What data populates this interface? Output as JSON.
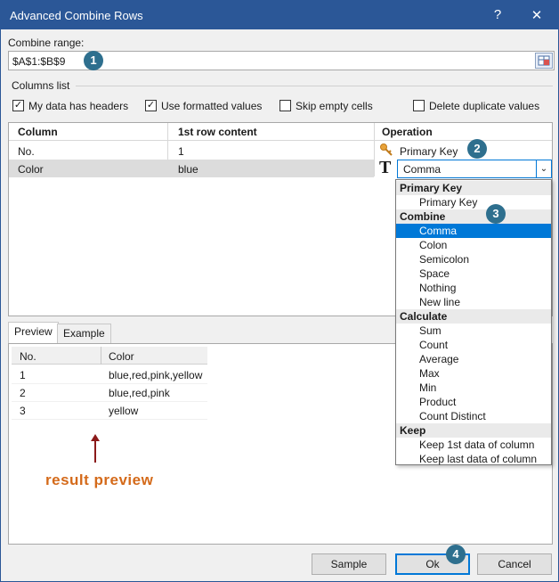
{
  "window": {
    "title": "Advanced Combine Rows",
    "help": "?",
    "close": "✕"
  },
  "range": {
    "label": "Combine range:",
    "value": "$A$1:$B$9"
  },
  "columns_list": {
    "label": "Columns list",
    "checks": [
      {
        "label": "My data has headers",
        "checked": true
      },
      {
        "label": "Use formatted values",
        "checked": true
      },
      {
        "label": "Skip empty cells",
        "checked": false
      },
      {
        "label": "Delete duplicate values",
        "checked": false
      }
    ]
  },
  "grid": {
    "headers": [
      "Column",
      "1st row content",
      "Operation"
    ],
    "rows": [
      {
        "column": "No.",
        "content": "1",
        "operation": "Primary Key"
      },
      {
        "column": "Color",
        "content": "blue",
        "operation": "Comma"
      }
    ]
  },
  "dropdown": {
    "groups": [
      {
        "title": "Primary Key",
        "items": [
          "Primary Key"
        ]
      },
      {
        "title": "Combine",
        "items": [
          "Comma",
          "Colon",
          "Semicolon",
          "Space",
          "Nothing",
          "New line"
        ]
      },
      {
        "title": "Calculate",
        "items": [
          "Sum",
          "Count",
          "Average",
          "Max",
          "Min",
          "Product",
          "Count Distinct"
        ]
      },
      {
        "title": "Keep",
        "items": [
          "Keep 1st data of column",
          "Keep last data of column"
        ]
      }
    ],
    "selected": "Comma"
  },
  "tabs": [
    "Preview",
    "Example"
  ],
  "preview": {
    "headers": [
      "No.",
      "Color"
    ],
    "rows": [
      [
        "1",
        "blue,red,pink,yellow"
      ],
      [
        "2",
        "blue,red,pink"
      ],
      [
        "3",
        "yellow"
      ]
    ]
  },
  "annotation": {
    "text": "result preview",
    "color": "#d46a1a"
  },
  "steps": [
    "1",
    "2",
    "3",
    "4"
  ],
  "buttons": {
    "sample": "Sample",
    "ok": "Ok",
    "cancel": "Cancel"
  },
  "colors": {
    "titlebar": "#2b5797",
    "selection": "#0078d7",
    "step_badge": "#2e6f8e"
  }
}
